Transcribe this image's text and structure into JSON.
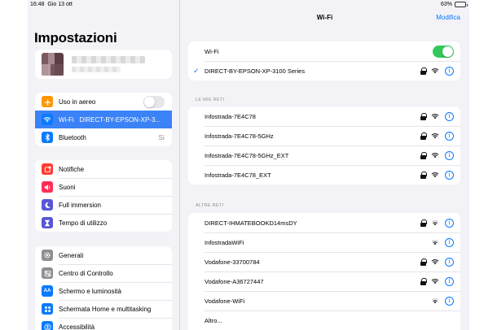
{
  "status_bar": {
    "time": "16:48",
    "date": "Gio 13 ott",
    "battery": "63%",
    "battery_level": 0.63
  },
  "sidebar": {
    "title": "Impostazioni",
    "group1": [
      {
        "label": "Uso in aereo",
        "icon": "airplane-icon",
        "color": "#ff9500",
        "toggle": "off"
      },
      {
        "label": "Wi-Fi",
        "value": "DIRECT-BY-EPSON-XP-3...",
        "icon": "wifi-icon",
        "color": "#0a7aff",
        "selected": true
      },
      {
        "label": "Bluetooth",
        "value": "Sì",
        "icon": "bluetooth-icon",
        "color": "#0a7aff"
      }
    ],
    "group2": [
      {
        "label": "Notifiche",
        "icon": "notification-icon",
        "color": "#ff3b30"
      },
      {
        "label": "Suoni",
        "icon": "speaker-icon",
        "color": "#ff2d55"
      },
      {
        "label": "Full immersion",
        "icon": "moon-icon",
        "color": "#5856d6"
      },
      {
        "label": "Tempo di utilizzo",
        "icon": "hourglass-icon",
        "color": "#5856d6"
      }
    ],
    "group3": [
      {
        "label": "Generali",
        "icon": "gear-icon",
        "color": "#8e8e93"
      },
      {
        "label": "Centro di Controllo",
        "icon": "control-center-icon",
        "color": "#8e8e93"
      },
      {
        "label": "Schermo e luminosità",
        "icon": "text-size-icon",
        "color": "#0a7aff"
      },
      {
        "label": "Schermata Home e multitasking",
        "icon": "grid-icon",
        "color": "#0a7aff"
      },
      {
        "label": "Accessibilità",
        "icon": "accessibility-icon",
        "color": "#0a7aff"
      }
    ]
  },
  "main": {
    "title": "Wi-Fi",
    "edit_label": "Modifica",
    "wifi_label": "Wi-Fi",
    "connected_network": "DIRECT-BY-EPSON-XP-3100 Series",
    "my_networks_header": "LE MIE RETI",
    "my_networks": [
      {
        "name": "Infostrada-7E4C78",
        "locked": true
      },
      {
        "name": "Infostrada-7E4C78-5GHz",
        "locked": true
      },
      {
        "name": "Infostrada-7E4C78-5GHz_EXT",
        "locked": true
      },
      {
        "name": "Infostrada-7E4C78_EXT",
        "locked": true
      }
    ],
    "other_networks_header": "ALTRE RETI",
    "other_networks": [
      {
        "name": "DIRECT-IHMATEBOOKD14msDY",
        "locked": true
      },
      {
        "name": "InfostradaWiFi",
        "locked": false
      },
      {
        "name": "Vodafone-33700784",
        "locked": true
      },
      {
        "name": "Vodafone-A36727447",
        "locked": true
      },
      {
        "name": "Vodafone-WiFi",
        "locked": false
      }
    ],
    "other_label": "Altro...",
    "accent": "#0a7aff",
    "toggle_on": "#34c759"
  }
}
